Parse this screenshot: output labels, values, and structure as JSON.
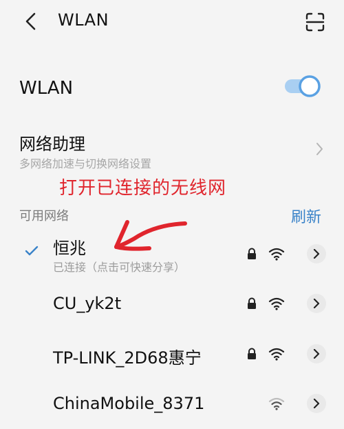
{
  "header": {
    "title": "WLAN",
    "back_icon": "back-chevron-icon",
    "scan_icon": "scan-icon"
  },
  "wlan_toggle": {
    "label": "WLAN",
    "state": "on",
    "accent_color": "#5aa1e3"
  },
  "assistant": {
    "title": "网络助理",
    "subtitle": "多网络加速与切换网络设置"
  },
  "annotation": {
    "text": "打开已连接的无线网",
    "color": "#e0252d"
  },
  "available": {
    "label": "可用网络",
    "refresh_label": "刷新"
  },
  "networks": [
    {
      "name": "恒兆",
      "status": "已连接（点击可快速分享）",
      "connected": true,
      "locked": true
    },
    {
      "name": "CU_yk2t",
      "status": "",
      "connected": false,
      "locked": true
    },
    {
      "name": "TP-LINK_2D68惠宁",
      "status": "",
      "connected": false,
      "locked": true
    },
    {
      "name": "ChinaMobile_8371",
      "status": "",
      "connected": false,
      "locked": false
    }
  ],
  "colors": {
    "link_blue": "#3a83c9",
    "check_blue": "#3a83c9",
    "background": "#f4f4f4"
  }
}
